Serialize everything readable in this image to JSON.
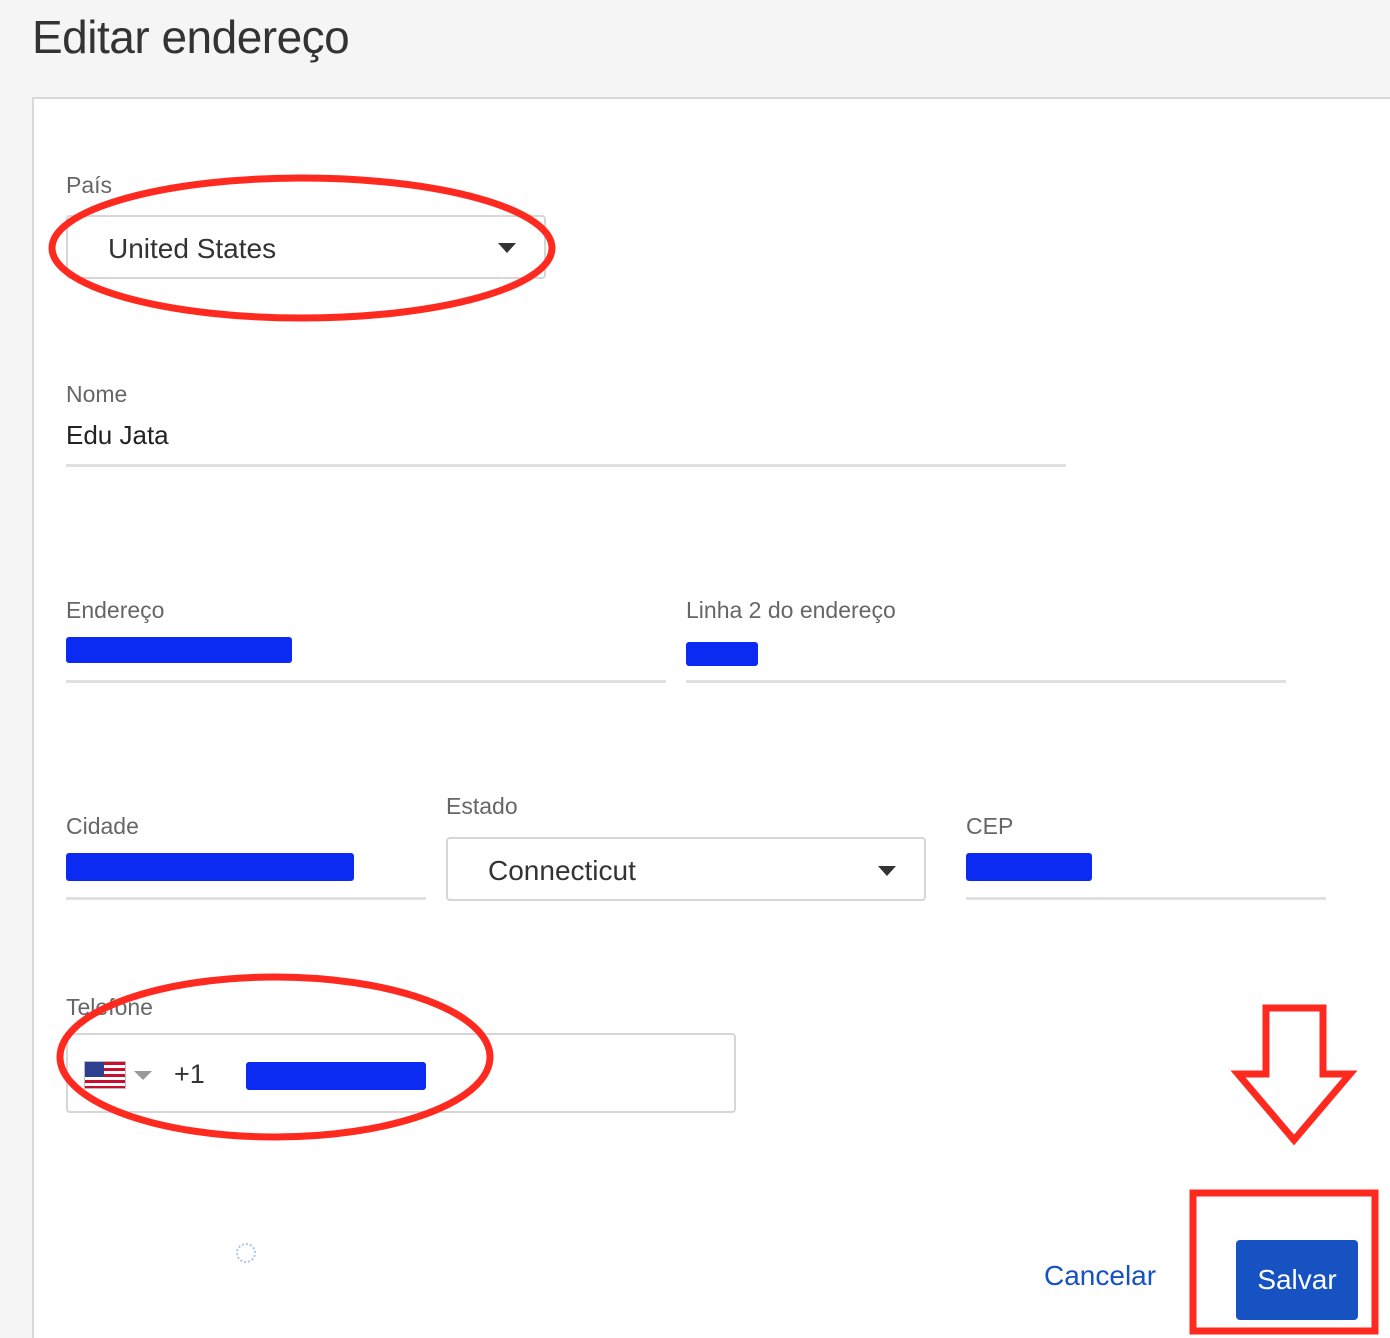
{
  "page": {
    "title": "Editar endereço"
  },
  "country": {
    "label": "País",
    "value": "United States"
  },
  "name": {
    "label": "Nome",
    "value": "Edu Jata"
  },
  "address": {
    "label": "Endereço",
    "value": ""
  },
  "address2": {
    "label": "Linha 2 do endereço",
    "value": ""
  },
  "city": {
    "label": "Cidade",
    "value": ""
  },
  "state": {
    "label": "Estado",
    "value": "Connecticut"
  },
  "zip": {
    "label": "CEP",
    "value": ""
  },
  "phone": {
    "label": "Telefone",
    "dial_code": "+1",
    "country_flag": "us-flag-icon",
    "value": ""
  },
  "actions": {
    "cancel_label": "Cancelar",
    "save_label": "Salvar"
  },
  "colors": {
    "accent": "#1652c2",
    "annotation": "#ff2a1f",
    "redaction": "#0b2af2"
  }
}
